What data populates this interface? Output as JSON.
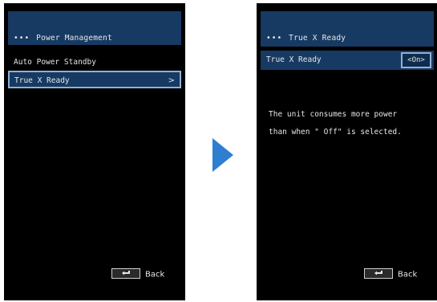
{
  "left_screen": {
    "header": {
      "dots": "•••",
      "title": "Power Management"
    },
    "items": [
      {
        "label": "Auto Power Standby"
      },
      {
        "label": "True X Ready",
        "chevron": ">"
      }
    ],
    "back_label": "Back"
  },
  "right_screen": {
    "header": {
      "dots": "•••",
      "title": "True X Ready"
    },
    "setting": {
      "label": "True X Ready",
      "value": "<On>"
    },
    "description": "The unit consumes more power\nthan when \" Off\"  is selected.",
    "back_label": "Back"
  },
  "colors": {
    "screen_bg": "#000000",
    "header_bg": "#173a63",
    "highlight_border": "#8fb0d8",
    "arrow": "#2f7fd0"
  },
  "icons": {
    "transition_arrow": "arrow-right-icon",
    "back_key": "return-key-icon",
    "chevron": "chevron-right-icon"
  }
}
